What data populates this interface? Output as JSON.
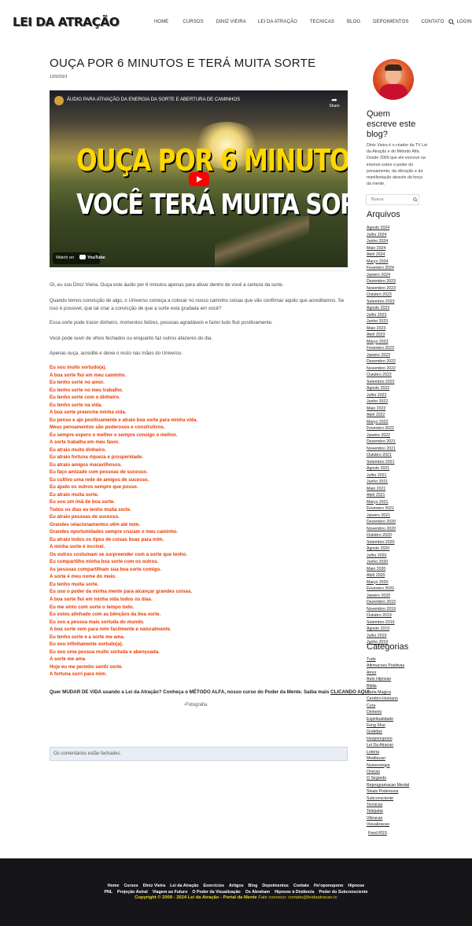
{
  "header": {
    "logo": "LEI DA ATRAÇÃO",
    "nav": [
      "Home",
      "Cursos",
      "Diniz Vieira",
      "Lei da Atração",
      "Tecnicas",
      "Blog",
      "Depoimentos",
      "Contato",
      "Login"
    ]
  },
  "post": {
    "title": "OUÇA POR 6 MINUTOS E TERÁ MUITA SORTE",
    "date": "13/9/2023",
    "video": {
      "title": "ÁUDIO PARA ATIVAÇÃO DA ENERGIA DA SORTE E ABERTURA DE CAMINHOS",
      "share": "Share",
      "line1": "OUÇA POR 6 MINUTOS",
      "line2": "VOCÊ TERÁ MUITA SORTE",
      "watch_on": "Watch on",
      "youtube": "YouTube"
    },
    "paragraphs": [
      "Oi, eu sou Diniz Vieira. Ouça este áudio por 6 minutos apenas para ativar dentro de você a certeza da sorte.",
      "Quando temos convicção de algo, o Universo começa a colocar no nosso caminho coisas que vão confirmar aquilo que acreditamos. Se isso é possível, que tal criar a convicção de que a sorte está grudada em você?",
      "Essa sorte pode trazer dinheiro, momentos felizes, pessoas agradáveis e fazer tudo fluir positivamente.",
      "Você pode ouvir de olhos fechados ou enquanto faz outros afazeres do dia.",
      "Apenas ouça, acredite e deixe o resto nas mãos do Universo."
    ],
    "affirmations": [
      "Eu sou muito sortudo(a).",
      "A boa sorte flui em meu caminho.",
      "Eu tenho sorte no amor.",
      "Eu tenho sorte no meu trabalho.",
      "Eu tenho sorte com o dinheiro.",
      "Eu tenho sorte na vida.",
      "A boa sorte preenche minha vida.",
      "Eu penso e ajo positivamente e atraio boa sorte para minha vida.",
      "Meus pensamentos são poderosos e construtivos.",
      "Eu sempre espero o melhor e sempre consigo o melhor.",
      "A sorte trabalha em meu favor.",
      "Eu atraio muito dinheiro.",
      "Eu atraio fortuna riqueza e prosperidade.",
      "Eu atraio amigos maravilhosos.",
      "Eu faço amizade com pessoas de sucesso.",
      "Eu cultivo uma rede de amigos de sucesso.",
      "Eu ajudo os outros sempre que posso.",
      "Eu atraio muita sorte.",
      "Eu sou um imã de boa sorte.",
      "Todos os dias eu tenho muita sorte.",
      "Eu atraio pessoas de sucesso.",
      "Grandes relacionamentos vêm até mim.",
      "Grandes oportunidades sempre cruzam o meu caminho.",
      "Eu atraio todos os tipos de coisas boas para mim.",
      "A minha sorte é incrível.",
      "Os outros costumam se surpreender com a sorte que tenho.",
      "Eu compartilho minha boa sorte com os outros.",
      "As pessoas compartilham sua boa sorte comigo.",
      "A sorte é meu nome do meio.",
      "Eu tenho muita sorte.",
      "Eu uso o poder da minha mente para alcançar grandes coisas.",
      "A boa sorte flui em minha vida todos os dias.",
      "Eu me sinto com sorte o tempo todo.",
      "Eu estou alinhado com as bênçãos da boa sorte.",
      "Eu sou a pessoa mais sortuda do mundo.",
      "A boa sorte vem para mim facilmente e naturalmente.",
      "Eu tenho sorte e a sorte me ama.",
      "Eu sou infinitamente sortudo(a).",
      "Eu sou uma pessoa muito sortuda e abençoada.",
      "A sorte me ama",
      "Hoje eu me permito sentir sorte.",
      "A fortuna sorri para mim."
    ],
    "cta_text": "Quer MUDAR DE VIDA usando a Lei da Atração? Conheça o MÉTODO ALFA, nosso curso do Poder da Mente. Saiba mais ",
    "cta_link": "CLICANDO AQUI",
    "photo_alt": "Fotografia",
    "comments_closed": "Os comentários estão fechados."
  },
  "sidebar": {
    "who_title": "Quem escreve este blog?",
    "who_text": "Diniz Vieira é o criador da TV Lei da Atração e do Método Alfa. Desde 2009 que ele escreve na internet sobre o poder do pensamento, da vibração e da manifestação através da força da mente.",
    "search_placeholder": "Busca",
    "archives_title": "Arquivos",
    "archives": [
      "Agosto 2024",
      "Julho 2024",
      "Junho 2024",
      "Maio 2024",
      "Abril 2024",
      "Março 2024",
      "Fevereiro 2024",
      "Janeiro 2024",
      "Dezembro 2023",
      "Novembro 2023",
      "Outubro 2023",
      "Setembro 2023",
      "Agosto 2023",
      "Julho 2023",
      "Junho 2023",
      "Maio 2023",
      "Abril 2023",
      "Março 2023",
      "Fevereiro 2023",
      "Janeiro 2023",
      "Dezembro 2022",
      "Novembro 2022",
      "Outubro 2022",
      "Setembro 2022",
      "Agosto 2022",
      "Julho 2022",
      "Junho 2022",
      "Maio 2022",
      "Abril 2022",
      "Março 2022",
      "Fevereiro 2022",
      "Janeiro 2022",
      "Dezembro 2021",
      "Novembro 2021",
      "Outubro 2021",
      "Setembro 2021",
      "Agosto 2021",
      "Julho 2021",
      "Junho 2021",
      "Maio 2021",
      "Abril 2021",
      "Março 2021",
      "Fevereiro 2021",
      "Janeiro 2021",
      "Dezembro 2020",
      "Novembro 2020",
      "Outubro 2020",
      "Setembro 2020",
      "Agosto 2020",
      "Julho 2020",
      "Junho 2020",
      "Maio 2020",
      "Abril 2020",
      "Março 2020",
      "Fevereiro 2020",
      "Janeiro 2020",
      "Dezembro 2019",
      "Novembro 2019",
      "Outubro 2019",
      "Setembro 2019",
      "Agosto 2019",
      "Julho 2019",
      "Junho 2019"
    ],
    "categories_title": "Categorias",
    "categories": [
      "Tudo",
      "Afirmacoes Positivas",
      "Amor",
      "Auto Hipnose",
      "Biblia",
      "Carta Magica",
      "Cerebro Humano",
      "Cura",
      "Dinheiro",
      "Espiritualidade",
      "Feng Shui",
      "Gratidao",
      "Hooponopono",
      "Lei Da Atracao",
      "Loteria",
      "Meditacao",
      "Numerologia",
      "Oracao",
      "O Segredo",
      "Reprogramacao Mental",
      "Sinais Poderosos",
      "Subconsciente",
      "Tecnicas",
      "Telepatia",
      "Vibracao",
      "Visualizacao"
    ],
    "feed": "Feed RSS"
  },
  "footer": {
    "links_row1": [
      "Home",
      "Cursos",
      "Diniz Vieira",
      "Lei da Atração",
      "Exercícios",
      "Artigos",
      "Blog",
      "Depoimentos",
      "Contato",
      "Ho'oponopono",
      "Hipnose"
    ],
    "links_row2": [
      "PNL",
      "Projeção Astral",
      "Viagem ao Futuro",
      "O Poder da Visualização",
      "Os Abraham",
      "Hipnose à Distância",
      "Poder do Subconsciente"
    ],
    "copyright": "Copyright © 2009 - 2024 Lei da Atração - Portal da Mente",
    "contact": " Fale conosco: contato@leidaatracao.tv"
  },
  "colors": {
    "affirmation": "#e63a00",
    "footer_bg": "#16161a",
    "copyright": "#e8d820",
    "comments_box": "#e8eef4"
  },
  "icons": [
    "search-icon",
    "share-icon",
    "youtube-play-icon"
  ]
}
